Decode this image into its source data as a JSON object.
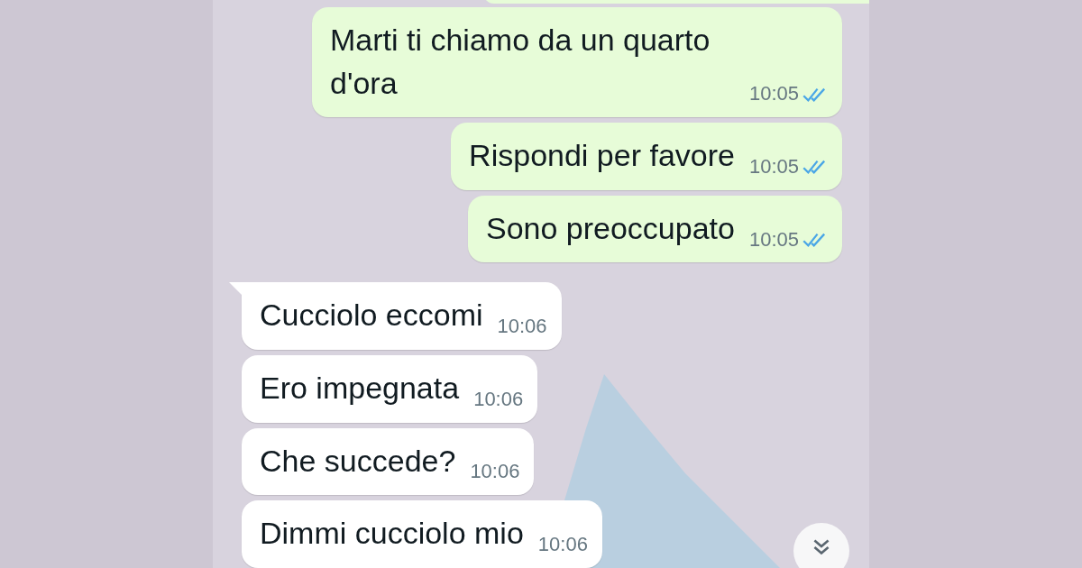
{
  "messages": [
    {
      "kind": "sent",
      "text": "Marti ti chiamo da un quarto d'ora",
      "time": "10:05",
      "read": true
    },
    {
      "kind": "sent",
      "text": "Rispondi per favore",
      "time": "10:05",
      "read": true
    },
    {
      "kind": "sent",
      "text": "Sono preoccupato",
      "time": "10:05",
      "read": true
    },
    {
      "kind": "received",
      "text": "Cucciolo eccomi",
      "time": "10:06",
      "first": true
    },
    {
      "kind": "received",
      "text": "Ero impegnata",
      "time": "10:06",
      "first": false
    },
    {
      "kind": "received",
      "text": "Che succede?",
      "time": "10:06",
      "first": false
    },
    {
      "kind": "received",
      "text": "Dimmi cucciolo mio",
      "time": "10:06",
      "first": false
    }
  ],
  "scroll_down_button": true
}
